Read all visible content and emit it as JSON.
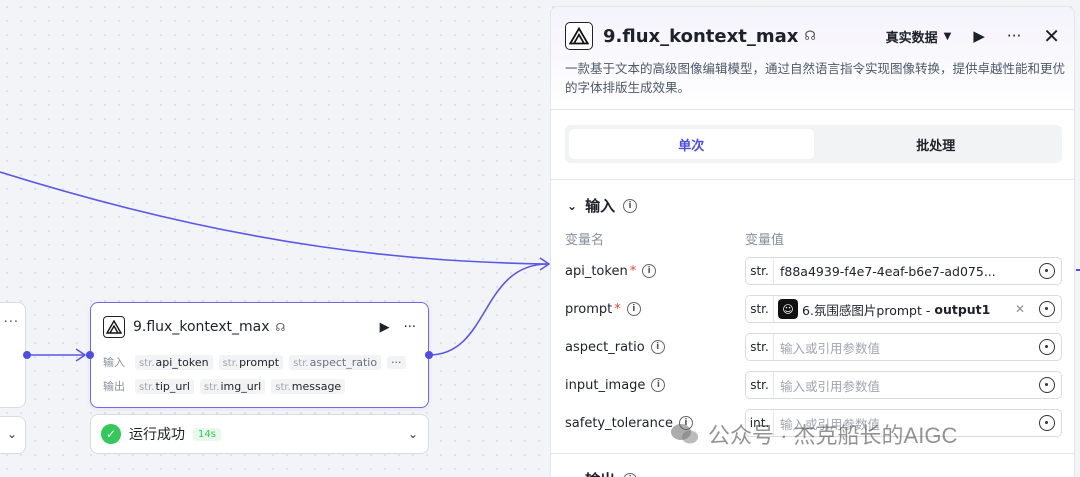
{
  "node": {
    "title": "9.flux_kontext_max",
    "input_label": "输入",
    "output_label": "输出",
    "inputs": [
      {
        "type": "str.",
        "name": "api_token"
      },
      {
        "type": "str.",
        "name": "prompt"
      },
      {
        "type": "str.",
        "name": "aspect_ratio"
      }
    ],
    "outputs": [
      {
        "type": "str.",
        "name": "tip_url"
      },
      {
        "type": "str.",
        "name": "img_url"
      },
      {
        "type": "str.",
        "name": "message"
      }
    ],
    "status_text": "运行成功",
    "duration": "14s"
  },
  "panel": {
    "title": "9.flux_kontext_max",
    "dataset_label": "真实数据",
    "description": "一款基于文本的高级图像编辑模型，通过自然语言指令实现图像转换，提供卓越性能和更优的字体排版生成效果。",
    "tabs": [
      "单次",
      "批处理"
    ],
    "active_tab": "单次",
    "input_section": "输入",
    "output_section": "输出",
    "col_name": "变量名",
    "col_value": "变量值",
    "params": [
      {
        "name": "api_token",
        "required": "*",
        "type": "str.",
        "value": "f88a4939-f4e7-4eaf-b6e7-ad075...",
        "placeholder": ""
      },
      {
        "name": "prompt",
        "required": "*",
        "type": "str.",
        "ref_label": "6.氛围感图片prompt - ",
        "ref_output": "output1"
      },
      {
        "name": "aspect_ratio",
        "required": "",
        "type": "str.",
        "value": "",
        "placeholder": "输入或引用参数值"
      },
      {
        "name": "input_image",
        "required": "",
        "type": "str.",
        "value": "",
        "placeholder": "输入或引用参数值"
      },
      {
        "name": "safety_tolerance",
        "required": "",
        "type": "int.",
        "value": "",
        "placeholder": "输入或引用参数值"
      }
    ]
  },
  "watermark": {
    "text": "公众号 · 杰克船长的AIGC"
  },
  "colors": {
    "accent": "#4e4ee6",
    "success": "#34c759",
    "required": "#f53f3f"
  }
}
